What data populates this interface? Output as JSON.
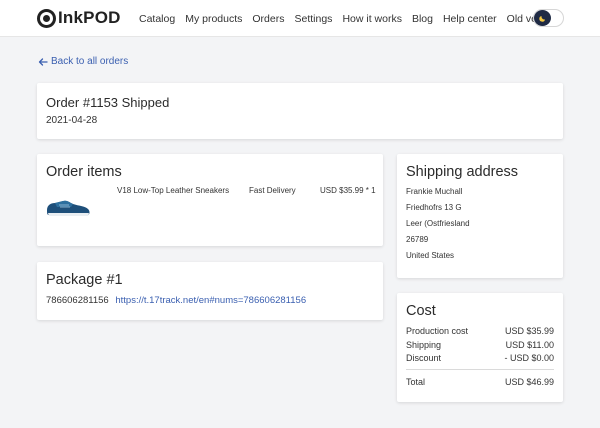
{
  "brand": {
    "name": "InkPOD"
  },
  "nav": {
    "items": [
      {
        "label": "Catalog"
      },
      {
        "label": "My products"
      },
      {
        "label": "Orders"
      },
      {
        "label": "Settings"
      },
      {
        "label": "How it works"
      },
      {
        "label": "Blog"
      },
      {
        "label": "Help center"
      },
      {
        "label": "Old version"
      }
    ],
    "theme_toggle_icon": "moon-icon"
  },
  "back_link": {
    "label": "Back to all orders"
  },
  "order": {
    "title": "Order #1153 Shipped",
    "date": "2021-04-28"
  },
  "order_items": {
    "title": "Order items",
    "items": [
      {
        "name": "V18 Low-Top Leather Sneakers",
        "delivery": "Fast Delivery",
        "price": "USD $35.99 * 1"
      }
    ]
  },
  "package": {
    "title": "Package #1",
    "tracking_number": "786606281156",
    "tracking_url": "https://t.17track.net/en#nums=786606281156"
  },
  "shipping": {
    "title": "Shipping address",
    "lines": [
      "Frankie Muchall",
      "Friedhofrs 13 G",
      "Leer (Ostfriesland",
      "26789",
      "United States"
    ]
  },
  "cost": {
    "title": "Cost",
    "rows": [
      {
        "label": "Production cost",
        "value": "USD $35.99"
      },
      {
        "label": "Shipping",
        "value": "USD $11.00"
      },
      {
        "label": "Discount",
        "value": "- USD $0.00"
      }
    ],
    "total": {
      "label": "Total",
      "value": "USD $46.99"
    }
  },
  "colors": {
    "link": "#3a5fb0",
    "background": "#f3f4f6",
    "toggle_knob": "#1f2a44"
  }
}
